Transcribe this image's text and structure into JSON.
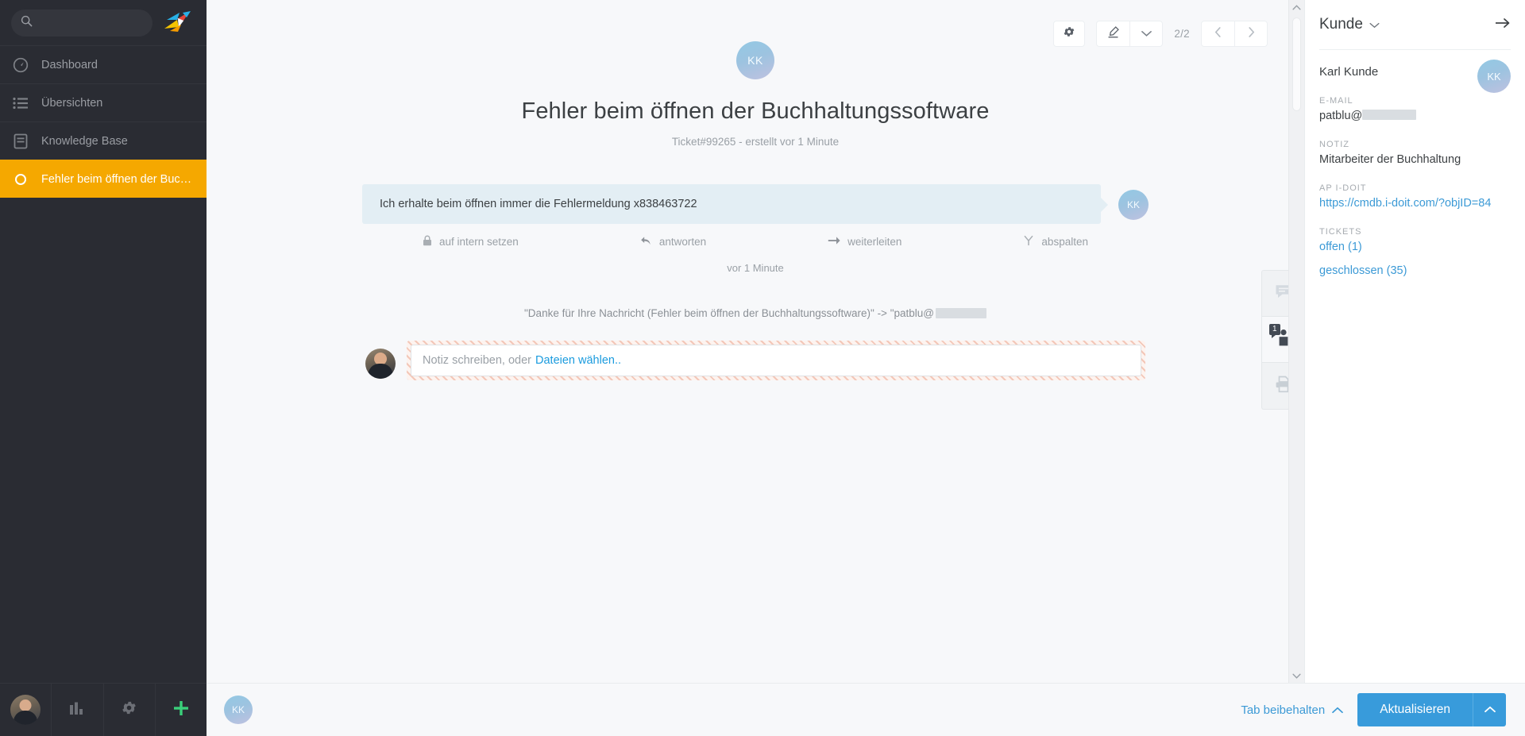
{
  "nav": {
    "search": {
      "placeholder": "",
      "value": "",
      "icon": "search-icon"
    },
    "logo": "zammad-logo",
    "items": [
      {
        "label": "Dashboard",
        "icon": "dashboard-icon",
        "active": false
      },
      {
        "label": "Übersichten",
        "icon": "list-icon",
        "active": false
      },
      {
        "label": "Knowledge Base",
        "icon": "book-icon",
        "active": false
      },
      {
        "label": "Fehler beim öffnen der Buchhal...",
        "icon": "ticket-state-icon",
        "active": true
      }
    ],
    "bottom": [
      {
        "name": "user-avatar",
        "icon": "avatar-photo"
      },
      {
        "name": "reports",
        "icon": "bar-chart-icon"
      },
      {
        "name": "settings",
        "icon": "gear-icon"
      },
      {
        "name": "new",
        "icon": "plus-icon"
      }
    ],
    "accent_active": "#f5a800",
    "background": "#2a2c33"
  },
  "ticket": {
    "avatar_initials": "KK",
    "title": "Fehler beim öffnen der Buchhaltungssoftware",
    "subtitle": "Ticket#99265 - erstellt vor 1 Minute",
    "toolbar": {
      "settings_icon": "gear-icon",
      "highlight_icon": "highlighter-icon",
      "highlight_caret_icon": "chevron-down-icon",
      "pager": "2/2",
      "prev_icon": "chevron-left-icon",
      "next_icon": "chevron-right-icon"
    }
  },
  "article": {
    "text": "Ich erhalte beim öffnen immer die Fehlermeldung x838463722",
    "avatar_initials": "KK",
    "actions": [
      {
        "label": "auf intern setzen",
        "icon": "lock-icon"
      },
      {
        "label": "antworten",
        "icon": "reply-icon"
      },
      {
        "label": "weiterleiten",
        "icon": "forward-icon"
      },
      {
        "label": "abspalten",
        "icon": "split-icon"
      }
    ],
    "time": "vor 1 Minute"
  },
  "system_note": {
    "prefix": "\"Danke für Ihre Nachricht (Fehler beim öffnen der Buchhaltungssoftware)\" -> \"patblu@",
    "redacted": true
  },
  "composer": {
    "placeholder": "Notiz schreiben, oder",
    "link_label": "Dateien wählen..",
    "mode": "internal-note",
    "border_color": "#f3c7b8"
  },
  "tabstrip": [
    {
      "name": "ticket-tab",
      "icon": "chat-bubble-icon",
      "active": false,
      "badge": null
    },
    {
      "name": "customer-tab",
      "icon": "person-icon",
      "active": true,
      "badge": "1"
    },
    {
      "name": "print-tab",
      "icon": "printer-icon",
      "active": false,
      "badge": null
    }
  ],
  "sidebar": {
    "title": "Kunde",
    "caret_icon": "chevron-down-icon",
    "expand_icon": "arrow-right-icon",
    "customer_name": "Karl Kunde",
    "avatar_initials": "KK",
    "fields": [
      {
        "label": "E-MAIL",
        "value": "patblu@",
        "redacted": true,
        "type": "text"
      },
      {
        "label": "NOTIZ",
        "value": "Mitarbeiter der Buchhaltung",
        "redacted": false,
        "type": "text"
      },
      {
        "label": "AP I-DOIT",
        "value": "https://cmdb.i-doit.com/?objID=84",
        "redacted": false,
        "type": "link"
      }
    ],
    "tickets_label": "TICKETS",
    "tickets": [
      {
        "label": "offen (1)"
      },
      {
        "label": "geschlossen (35)"
      }
    ],
    "link_color": "#3c9ad6"
  },
  "bottombar": {
    "avatar_initials": "KK",
    "keep_tab_label": "Tab beibehalten",
    "keep_tab_icon": "chevron-up-icon",
    "submit_label": "Aktualisieren",
    "submit_caret_icon": "chevron-up-icon",
    "submit_color": "#389bdb"
  },
  "scrollbar": {
    "up_icon": "chevron-up-icon",
    "down_icon": "chevron-down-icon"
  }
}
